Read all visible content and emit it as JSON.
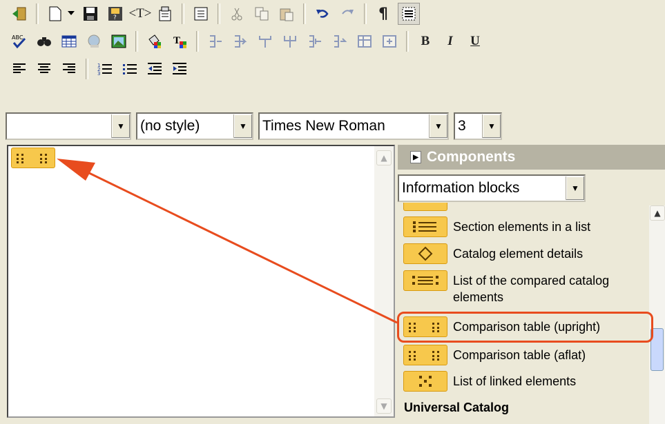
{
  "toolbar1": {
    "icons": [
      "exit-icon",
      "new-document-icon",
      "dropdown-arrow-icon",
      "save-icon",
      "save-as-icon",
      "text-tag-icon",
      "properties-icon",
      "page-view-icon",
      "cut-icon",
      "copy-icon",
      "paste-icon",
      "undo-icon",
      "redo-icon",
      "paragraph-icon",
      "borders-icon"
    ],
    "tag_label": "<T>",
    "paragraph_label": "¶"
  },
  "toolbar2": {
    "icons": [
      "spellcheck-icon",
      "find-icon",
      "table-icon",
      "web-link-icon",
      "image-icon",
      "color-icon",
      "text-color-icon",
      "table-insert-col-icon",
      "table-insert-row-icon",
      "table-merge-icon",
      "table-split-icon",
      "table-col-left-icon",
      "table-col-right-icon",
      "table-props-icon",
      "cell-props-icon",
      "bold-icon",
      "italic-icon",
      "underline-icon"
    ],
    "bold_label": "B",
    "italic_label": "I",
    "underline_label": "U",
    "spell_label": "ABC"
  },
  "toolbar3": {
    "icons": [
      "align-left-icon",
      "align-center-icon",
      "align-right-icon",
      "numbered-list-icon",
      "bulleted-list-icon",
      "outdent-icon",
      "indent-icon"
    ]
  },
  "format_bar": {
    "block_value": "",
    "style_value": "(no style)",
    "font_value": "Times New Roman",
    "size_value": "3"
  },
  "panel": {
    "header": "Components",
    "category_value": "Information blocks",
    "items": [
      {
        "label": "Section elements in a list",
        "icon": "section-list-icon"
      },
      {
        "label": "Catalog element details",
        "icon": "diamond-icon"
      },
      {
        "label": "List of the compared catalog elements",
        "icon": "compare-list-icon"
      },
      {
        "label": "Comparison table (upright)",
        "icon": "comparison-table-icon"
      },
      {
        "label": "Comparison table (aflat)",
        "icon": "comparison-table-icon"
      },
      {
        "label": "List of linked elements",
        "icon": "linked-elements-icon"
      }
    ],
    "section_label": "Universal Catalog"
  },
  "colors": {
    "accent": "#e84c1e",
    "icon_fill": "#f7c84c",
    "icon_border": "#d89a10",
    "panel_header": "#b6b3a3",
    "chrome": "#ece9d8"
  }
}
